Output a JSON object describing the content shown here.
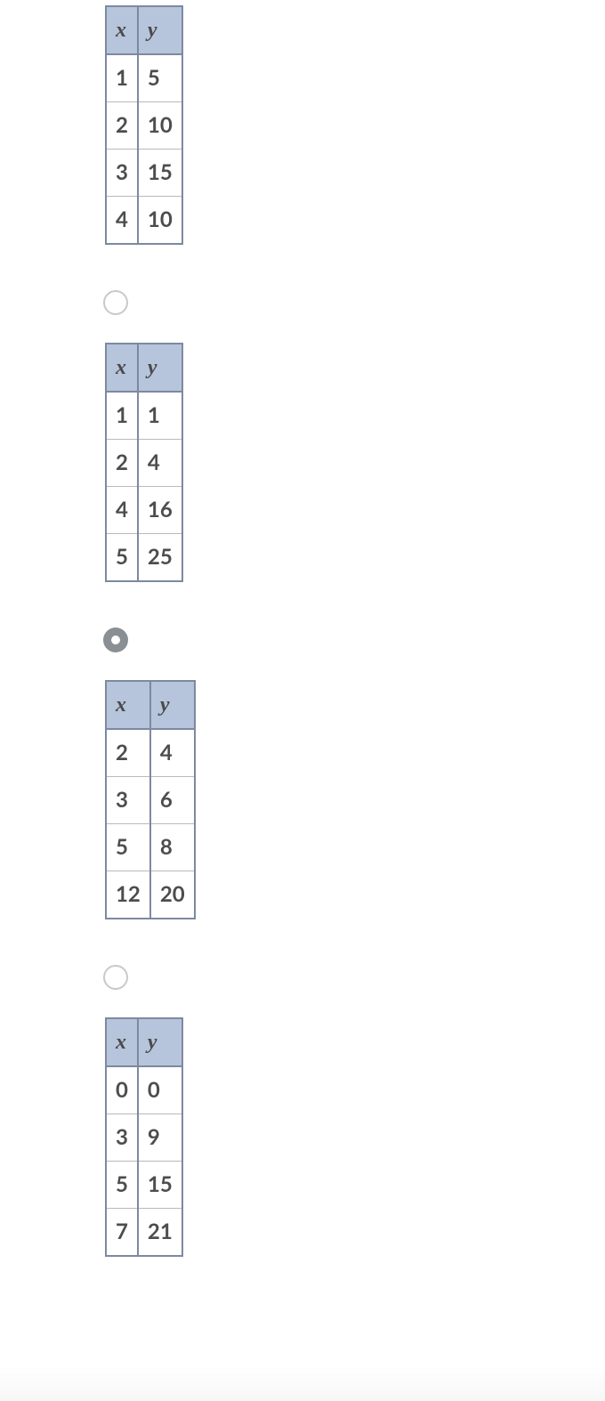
{
  "headers": {
    "x": "x",
    "y": "y"
  },
  "options": [
    {
      "selected": false,
      "show_radio": false,
      "rows": [
        {
          "x": "1",
          "y": "5"
        },
        {
          "x": "2",
          "y": "10"
        },
        {
          "x": "3",
          "y": "15"
        },
        {
          "x": "4",
          "y": "10"
        }
      ]
    },
    {
      "selected": false,
      "show_radio": true,
      "rows": [
        {
          "x": "1",
          "y": "1"
        },
        {
          "x": "2",
          "y": "4"
        },
        {
          "x": "4",
          "y": "16"
        },
        {
          "x": "5",
          "y": "25"
        }
      ]
    },
    {
      "selected": true,
      "show_radio": true,
      "rows": [
        {
          "x": "2",
          "y": "4"
        },
        {
          "x": "3",
          "y": "6"
        },
        {
          "x": "5",
          "y": "8"
        },
        {
          "x": "12",
          "y": "20"
        }
      ]
    },
    {
      "selected": false,
      "show_radio": true,
      "rows": [
        {
          "x": "0",
          "y": "0"
        },
        {
          "x": "3",
          "y": "9"
        },
        {
          "x": "5",
          "y": "15"
        },
        {
          "x": "7",
          "y": "21"
        }
      ]
    }
  ],
  "chart_data": [
    {
      "type": "table",
      "columns": [
        "x",
        "y"
      ],
      "rows": [
        [
          1,
          5
        ],
        [
          2,
          10
        ],
        [
          3,
          15
        ],
        [
          4,
          10
        ]
      ]
    },
    {
      "type": "table",
      "columns": [
        "x",
        "y"
      ],
      "rows": [
        [
          1,
          1
        ],
        [
          2,
          4
        ],
        [
          4,
          16
        ],
        [
          5,
          25
        ]
      ]
    },
    {
      "type": "table",
      "columns": [
        "x",
        "y"
      ],
      "rows": [
        [
          2,
          4
        ],
        [
          3,
          6
        ],
        [
          5,
          8
        ],
        [
          12,
          20
        ]
      ]
    },
    {
      "type": "table",
      "columns": [
        "x",
        "y"
      ],
      "rows": [
        [
          0,
          0
        ],
        [
          3,
          9
        ],
        [
          5,
          15
        ],
        [
          7,
          21
        ]
      ]
    }
  ]
}
